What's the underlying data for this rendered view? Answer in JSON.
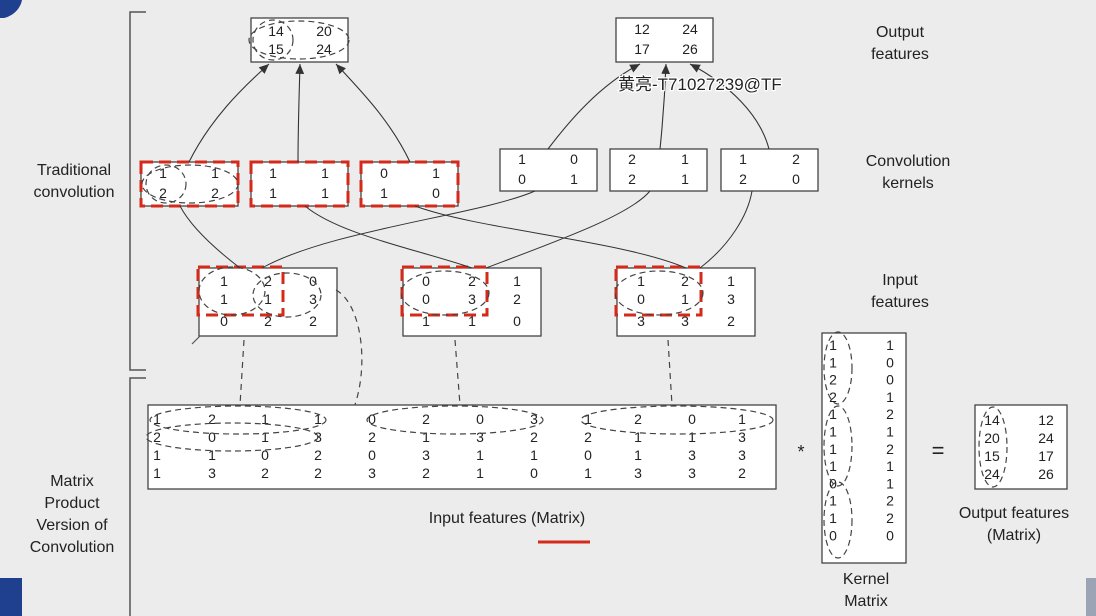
{
  "labels": {
    "traditional": [
      "Traditional",
      "convolution"
    ],
    "matrix_version": [
      "Matrix",
      "Product",
      "Version of",
      "Convolution"
    ],
    "output_features": [
      "Output",
      "features"
    ],
    "conv_kernels": [
      "Convolution",
      "kernels"
    ],
    "input_features": [
      "Input",
      "features"
    ],
    "input_matrix": "Input features (Matrix)",
    "kernel_matrix": [
      "Kernel",
      "Matrix"
    ],
    "output_matrix": [
      "Output features",
      "(Matrix)"
    ],
    "watermark": "黄亮-T71027239@TF",
    "star": "*",
    "equals": "="
  },
  "output_features": [
    [
      [
        "14",
        "20"
      ],
      [
        "15",
        "24"
      ]
    ],
    [
      [
        "12",
        "24"
      ],
      [
        "17",
        "26"
      ]
    ]
  ],
  "input_kernels": [
    [
      [
        "1",
        "1"
      ],
      [
        "2",
        "2"
      ]
    ],
    [
      [
        "1",
        "1"
      ],
      [
        "1",
        "1"
      ]
    ],
    [
      [
        "0",
        "1"
      ],
      [
        "1",
        "0"
      ]
    ]
  ],
  "conv_kernels": [
    [
      [
        "1",
        "0"
      ],
      [
        "0",
        "1"
      ]
    ],
    [
      [
        "2",
        "1"
      ],
      [
        "2",
        "1"
      ]
    ],
    [
      [
        "1",
        "2"
      ],
      [
        "2",
        "0"
      ]
    ]
  ],
  "input_features": [
    [
      [
        "1",
        "2",
        "0"
      ],
      [
        "1",
        "1",
        "3"
      ],
      [
        "0",
        "2",
        "2"
      ]
    ],
    [
      [
        "0",
        "2",
        "1"
      ],
      [
        "0",
        "3",
        "2"
      ],
      [
        "1",
        "1",
        "0"
      ]
    ],
    [
      [
        "1",
        "2",
        "1"
      ],
      [
        "0",
        "1",
        "3"
      ],
      [
        "3",
        "3",
        "2"
      ]
    ]
  ],
  "input_matrix": [
    [
      "1",
      "2",
      "1",
      "1",
      "0",
      "2",
      "0",
      "3",
      "1",
      "2",
      "0",
      "1"
    ],
    [
      "2",
      "0",
      "1",
      "3",
      "2",
      "1",
      "3",
      "2",
      "2",
      "1",
      "1",
      "3"
    ],
    [
      "1",
      "1",
      "0",
      "2",
      "0",
      "3",
      "1",
      "1",
      "0",
      "1",
      "3",
      "3"
    ],
    [
      "1",
      "3",
      "2",
      "2",
      "3",
      "2",
      "1",
      "0",
      "1",
      "3",
      "3",
      "2"
    ]
  ],
  "kernel_matrix": [
    [
      "1",
      "1"
    ],
    [
      "1",
      "0"
    ],
    [
      "2",
      "0"
    ],
    [
      "2",
      "1"
    ],
    [
      "1",
      "2"
    ],
    [
      "1",
      "1"
    ],
    [
      "1",
      "2"
    ],
    [
      "1",
      "1"
    ],
    [
      "0",
      "1"
    ],
    [
      "1",
      "2"
    ],
    [
      "1",
      "2"
    ],
    [
      "0",
      "0"
    ]
  ],
  "output_matrix": [
    [
      "14",
      "12"
    ],
    [
      "20",
      "24"
    ],
    [
      "15",
      "17"
    ],
    [
      "24",
      "26"
    ]
  ],
  "colors": {
    "highlight": "#d42a1a",
    "background": "#ececec"
  }
}
